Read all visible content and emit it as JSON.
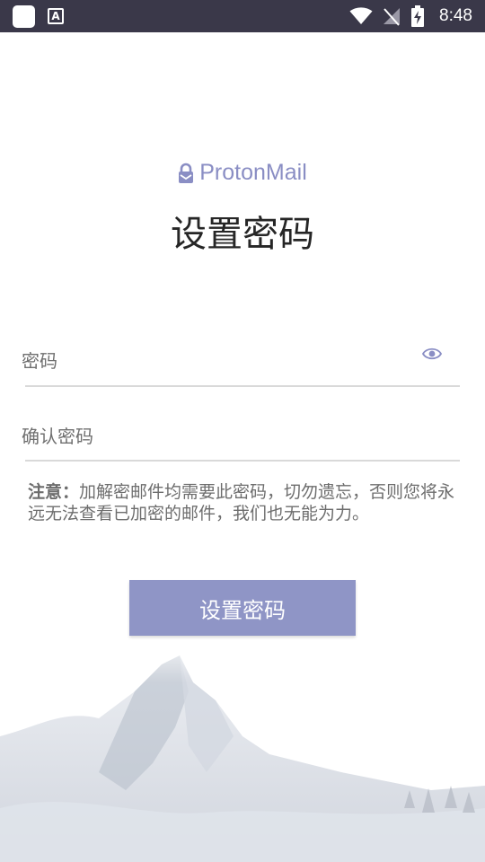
{
  "status_bar": {
    "time": "8:48",
    "icons": [
      "app-square-icon",
      "font-a-icon",
      "wifi-icon",
      "no-signal-icon",
      "battery-charging-icon"
    ],
    "text_icon_glyph": "A"
  },
  "logo": {
    "text": "ProtonMail",
    "icon": "proton-lock-icon"
  },
  "page": {
    "title": "设置密码"
  },
  "fields": {
    "password_label": "密码",
    "confirm_label": "确认密码",
    "eye_icon": "eye-icon"
  },
  "note": {
    "prefix": "注意：",
    "text": "加解密邮件均需要此密码，切勿遗忘，否则您将永远无法查看已加密的邮件，我们也无能为力。"
  },
  "button": {
    "label": "设置密码"
  },
  "colors": {
    "accent": "#8f95c6",
    "logo": "#8a8ec4",
    "status_bar": "#3a3849"
  }
}
